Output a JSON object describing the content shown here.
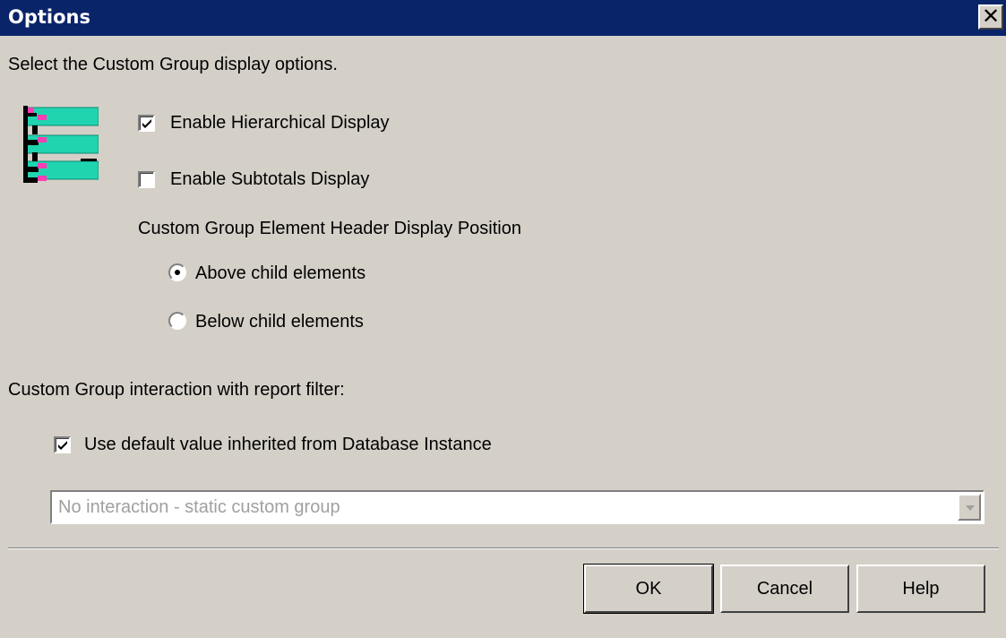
{
  "window": {
    "title": "Options",
    "close_symbol": "✕"
  },
  "intro_text": "Select the Custom Group display options.",
  "hierarchy_icon": "hierarchy-display-icon",
  "enable_hierarchical": {
    "label": "Enable Hierarchical Display",
    "checked": true
  },
  "enable_subtotals": {
    "label": "Enable Subtotals Display",
    "checked": false
  },
  "header_position": {
    "label": "Custom Group Element Header Display Position",
    "options": [
      {
        "label": "Above child elements",
        "selected": true
      },
      {
        "label": "Below child elements",
        "selected": false
      }
    ]
  },
  "filter_interaction": {
    "label": "Custom Group interaction with report filter:",
    "use_default": {
      "label": "Use default value inherited from Database Instance",
      "checked": true
    },
    "dropdown": {
      "value": "No interaction - static custom group",
      "enabled": false
    }
  },
  "buttons": {
    "ok": "OK",
    "cancel": "Cancel",
    "help": "Help"
  },
  "colors": {
    "title_bar": "#0a246a",
    "dialog_bg": "#d4d0c8",
    "icon_teal": "#20d4b0",
    "icon_pink": "#ff3cb4"
  }
}
